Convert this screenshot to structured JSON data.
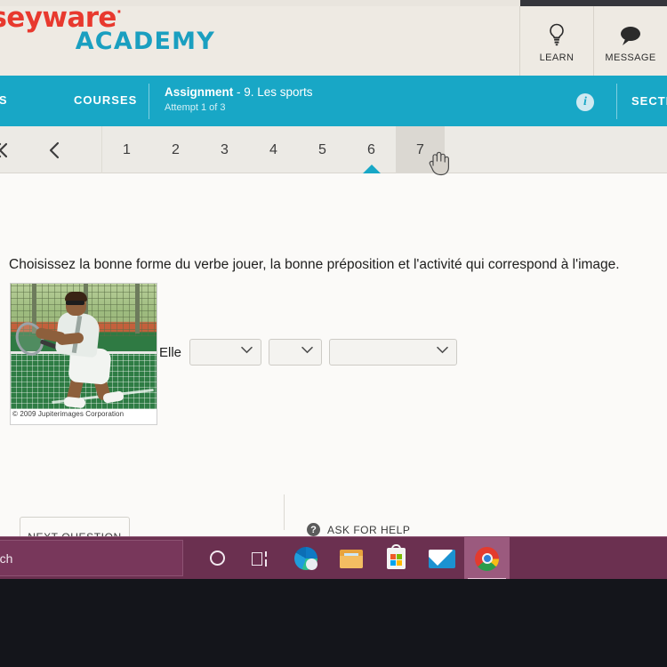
{
  "header": {
    "logo_brand": "ysseyware",
    "logo_brand_dot": "·",
    "logo_sub": "ACADEMY",
    "tools": [
      {
        "label": "LEARN",
        "icon": "lightbulb-icon"
      },
      {
        "label": "MESSAGE",
        "icon": "speech-bubble-icon"
      }
    ]
  },
  "navbar": {
    "assignments_label": "MENTS",
    "courses_label": "COURSES",
    "assignment_title_bold": "Assignment",
    "assignment_title_rest": " - 9. Les sports",
    "attempt_text": "Attempt 1 of 3",
    "info_icon_char": "i",
    "sections_label": "SECTIONS",
    "teal_color": "#18a7c6"
  },
  "question_tabs": {
    "first_arrow": "«",
    "prev_arrow": "‹",
    "numbers": [
      "1",
      "2",
      "3",
      "4",
      "5",
      "6",
      "7"
    ],
    "active_index": 5,
    "hovered_index": 6
  },
  "question": {
    "prompt": "Choisissez la bonne forme du verbe jouer, la bonne préposition et l'activité qui correspond à l'image.",
    "image_caption": "© 2009 Jupiterimages Corporation",
    "image_alt": "tennis-player-photo",
    "subject_word": "Elle",
    "dropdowns": [
      {
        "value": "",
        "chevron": "∨"
      },
      {
        "value": "",
        "chevron": "∨"
      },
      {
        "value": "",
        "chevron": "∨"
      }
    ]
  },
  "actions": {
    "next_question_label": "NEXT QUESTION",
    "ask_for_help_label": "ASK FOR HELP",
    "help_icon_char": "?"
  },
  "taskbar": {
    "search_text": "rch",
    "cortana_icon": "cortana-circle-icon",
    "items": [
      {
        "name": "task-view",
        "label": "Task View"
      },
      {
        "name": "microsoft-edge",
        "label": "Microsoft Edge"
      },
      {
        "name": "file-explorer",
        "label": "File Explorer"
      },
      {
        "name": "microsoft-store",
        "label": "Microsoft Store"
      },
      {
        "name": "mail",
        "label": "Mail"
      },
      {
        "name": "google-chrome",
        "label": "Google Chrome"
      }
    ],
    "active_item_index": 5,
    "bar_color": "#6b3050"
  }
}
